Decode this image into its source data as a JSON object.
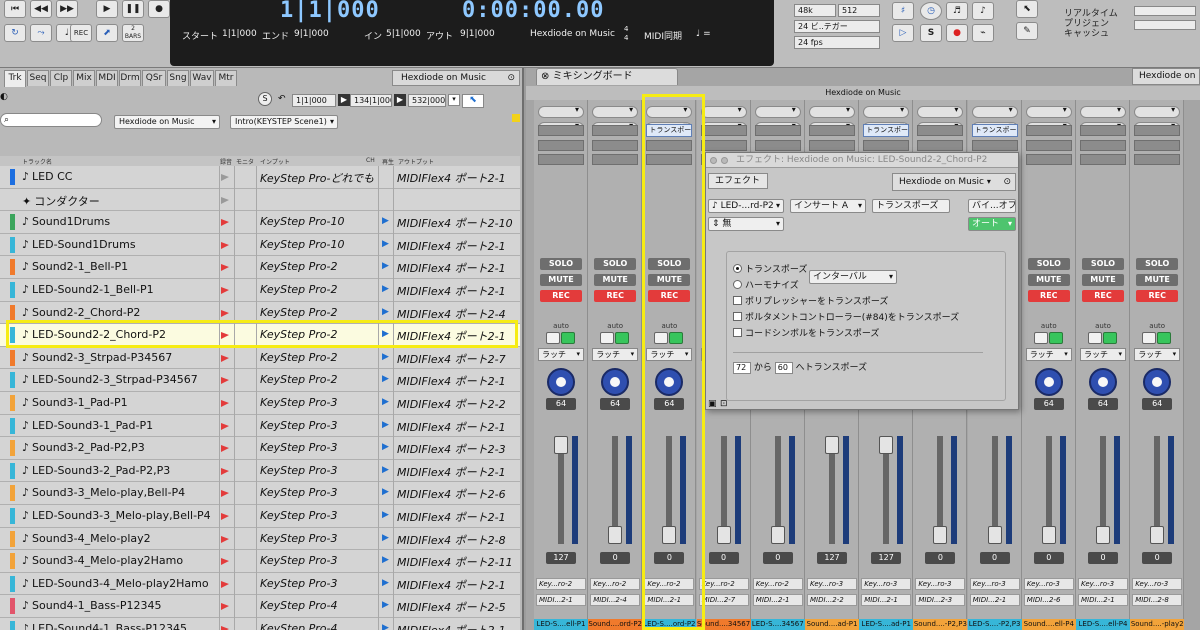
{
  "transport": {
    "measure": "1|1|000",
    "time": "0:00:00.00",
    "start_label": "スタート",
    "start_value": "1|1|000",
    "end_label": "エンド",
    "end_value": "9|1|000",
    "in_label": "イン",
    "in_value": "5|1|000",
    "out_label": "アウト",
    "out_value": "9|1|000",
    "project": "Hexdiode on Music",
    "time_sig_top": "4",
    "time_sig_bottom": "4",
    "midi_sync": "MIDI同期",
    "tempo_note": "♩ =",
    "rec_label": "REC",
    "bars_label": "2\nBARS",
    "sample_rate": "48k",
    "buffer": "512",
    "bit_depth": "24 ビ..テガー",
    "fps": "24 fps",
    "right_text": [
      "リアルタイム",
      "プリジェン",
      "キャッシュ"
    ]
  },
  "tracks_panel": {
    "tabs": [
      "Trk",
      "Seq",
      "Clp",
      "Mix",
      "MDI",
      "Drm",
      "QSr",
      "Sng",
      "Wav",
      "Mtr"
    ],
    "active_tab": "Trk",
    "title": "Hexdiode on Music",
    "project_select": "Hexdiode on Music",
    "scene_select": "Intro(KEYSTEP Scene1)",
    "counter_1": "1|1|000",
    "counter_2": "134|1|000",
    "counter_3": "532|000",
    "s_btn": "S",
    "col_track": "トラック名",
    "col_rec": "録音",
    "col_mon": "モニタ",
    "col_input": "インプット",
    "col_ch": "CH",
    "col_play": "再生",
    "col_output": "アウトプット",
    "rows": [
      {
        "name": "LED CC",
        "input": "KeyStep Pro-どれでも",
        "output": "MIDIFlex4 ポート2-1",
        "color": "#1c6ee0",
        "rec": false,
        "ch": false,
        "icon": "♪"
      },
      {
        "name": "コンダクター",
        "input": "",
        "output": "",
        "color": "#d4d4d4",
        "rec": false,
        "ch": false,
        "icon": "✦"
      },
      {
        "name": "Sound1Drums",
        "input": "KeyStep Pro-10",
        "output": "MIDIFlex4 ポート2-10",
        "color": "#3ba55c",
        "rec": true,
        "ch": true,
        "icon": "♪"
      },
      {
        "name": "LED-Sound1Drums",
        "input": "KeyStep Pro-10",
        "output": "MIDIFlex4 ポート2-1",
        "color": "#37b6d8",
        "rec": true,
        "ch": true,
        "icon": "♪"
      },
      {
        "name": "Sound2-1_Bell-P1",
        "input": "KeyStep Pro-2",
        "output": "MIDIFlex4 ポート2-1",
        "color": "#f07a2c",
        "rec": true,
        "ch": true,
        "icon": "♪"
      },
      {
        "name": "LED-Sound2-1_Bell-P1",
        "input": "KeyStep Pro-2",
        "output": "MIDIFlex4 ポート2-1",
        "color": "#37b6d8",
        "rec": true,
        "ch": true,
        "icon": "♪"
      },
      {
        "name": "Sound2-2_Chord-P2",
        "input": "KeyStep Pro-2",
        "output": "MIDIFlex4 ポート2-4",
        "color": "#f07a2c",
        "rec": true,
        "ch": true,
        "icon": "♪"
      },
      {
        "name": "LED-Sound2-2_Chord-P2",
        "input": "KeyStep Pro-2",
        "output": "MIDIFlex4 ポート2-1",
        "color": "#37b6d8",
        "rec": true,
        "ch": true,
        "icon": "♪"
      },
      {
        "name": "Sound2-3_Strpad-P34567",
        "input": "KeyStep Pro-2",
        "output": "MIDIFlex4 ポート2-7",
        "color": "#f07a2c",
        "rec": true,
        "ch": true,
        "icon": "♪"
      },
      {
        "name": "LED-Sound2-3_Strpad-P34567",
        "input": "KeyStep Pro-2",
        "output": "MIDIFlex4 ポート2-1",
        "color": "#37b6d8",
        "rec": true,
        "ch": true,
        "icon": "♪"
      },
      {
        "name": "Sound3-1_Pad-P1",
        "input": "KeyStep Pro-3",
        "output": "MIDIFlex4 ポート2-2",
        "color": "#f2a33a",
        "rec": true,
        "ch": true,
        "icon": "♪"
      },
      {
        "name": "LED-Sound3-1_Pad-P1",
        "input": "KeyStep Pro-3",
        "output": "MIDIFlex4 ポート2-1",
        "color": "#37b6d8",
        "rec": true,
        "ch": true,
        "icon": "♪"
      },
      {
        "name": "Sound3-2_Pad-P2,P3",
        "input": "KeyStep Pro-3",
        "output": "MIDIFlex4 ポート2-3",
        "color": "#f2a33a",
        "rec": true,
        "ch": true,
        "icon": "♪"
      },
      {
        "name": "LED-Sound3-2_Pad-P2,P3",
        "input": "KeyStep Pro-3",
        "output": "MIDIFlex4 ポート2-1",
        "color": "#37b6d8",
        "rec": true,
        "ch": true,
        "icon": "♪"
      },
      {
        "name": "Sound3-3_Melo-play,Bell-P4",
        "input": "KeyStep Pro-3",
        "output": "MIDIFlex4 ポート2-6",
        "color": "#f2a33a",
        "rec": true,
        "ch": true,
        "icon": "♪"
      },
      {
        "name": "LED-Sound3-3_Melo-play,Bell-P4",
        "input": "KeyStep Pro-3",
        "output": "MIDIFlex4 ポート2-1",
        "color": "#37b6d8",
        "rec": true,
        "ch": true,
        "icon": "♪"
      },
      {
        "name": "Sound3-4_Melo-play2",
        "input": "KeyStep Pro-3",
        "output": "MIDIFlex4 ポート2-8",
        "color": "#f2a33a",
        "rec": true,
        "ch": true,
        "icon": "♪"
      },
      {
        "name": "Sound3-4_Melo-play2Hamo",
        "input": "KeyStep Pro-3",
        "output": "MIDIFlex4 ポート2-11",
        "color": "#f2a33a",
        "rec": true,
        "ch": true,
        "icon": "♪"
      },
      {
        "name": "LED-Sound3-4_Melo-play2Hamo",
        "input": "KeyStep Pro-3",
        "output": "MIDIFlex4 ポート2-1",
        "color": "#37b6d8",
        "rec": true,
        "ch": true,
        "icon": "♪"
      },
      {
        "name": "Sound4-1_Bass-P12345",
        "input": "KeyStep Pro-4",
        "output": "MIDIFlex4 ポート2-5",
        "color": "#e2556b",
        "rec": true,
        "ch": true,
        "icon": "♪"
      },
      {
        "name": "LED-Sound4-1_Bass-P12345",
        "input": "KeyStep Pro-4",
        "output": "MIDIFlex4 ポート2-1",
        "color": "#37b6d8",
        "rec": true,
        "ch": true,
        "icon": "♪"
      }
    ]
  },
  "mixer": {
    "tab_label": "ミキシングボード",
    "right_tab": "Hexdiode on Music",
    "header": "Hexdiode on Music",
    "solo": "SOLO",
    "mute": "MUTE",
    "rec": "REC",
    "auto": "auto",
    "latch": "ラッチ",
    "insert_label": "トランスポー",
    "strips": [
      {
        "name": "LED-S....ell-P1",
        "in": "Key...ro-2",
        "out": "MIDI...2-1",
        "pan": "64",
        "vol": "127",
        "fader": 1.0,
        "color": "#37b6d8",
        "insert": false
      },
      {
        "name": "Sound....ord-P2",
        "in": "Key...ro-2",
        "out": "MIDI...2-4",
        "pan": "64",
        "vol": "0",
        "fader": 0.0,
        "color": "#f07a2c",
        "insert": false
      },
      {
        "name": "LED-S....ord-P2",
        "in": "Key...ro-2",
        "out": "MIDI...2-1",
        "pan": "64",
        "vol": "0",
        "fader": 0.0,
        "color": "#37b6d8",
        "insert": true
      },
      {
        "name": "Sound....34567",
        "in": "Key...ro-2",
        "out": "MIDI...2-7",
        "pan": "64",
        "vol": "0",
        "fader": 0.0,
        "color": "#f07a2c",
        "insert": false
      },
      {
        "name": "LED-S....34567",
        "in": "Key...ro-2",
        "out": "MIDI...2-1",
        "pan": "64",
        "vol": "0",
        "fader": 0.0,
        "color": "#37b6d8",
        "insert": false
      },
      {
        "name": "Sound....ad-P1",
        "in": "Key...ro-3",
        "out": "MIDI...2-2",
        "pan": "64",
        "vol": "127",
        "fader": 1.0,
        "color": "#f2a33a",
        "insert": false
      },
      {
        "name": "LED-S....ad-P1",
        "in": "Key...ro-3",
        "out": "MIDI...2-1",
        "pan": "64",
        "vol": "127",
        "fader": 1.0,
        "color": "#37b6d8",
        "insert": true
      },
      {
        "name": "Sound....-P2,P3",
        "in": "Key...ro-3",
        "out": "MIDI...2-3",
        "pan": "64",
        "vol": "0",
        "fader": 0.0,
        "color": "#f2a33a",
        "insert": false
      },
      {
        "name": "LED-S....-P2,P3",
        "in": "Key...ro-3",
        "out": "MIDI...2-1",
        "pan": "64",
        "vol": "0",
        "fader": 0.0,
        "color": "#37b6d8",
        "insert": true
      },
      {
        "name": "Sound....ell-P4",
        "in": "Key...ro-3",
        "out": "MIDI...2-6",
        "pan": "64",
        "vol": "0",
        "fader": 0.0,
        "color": "#f2a33a",
        "insert": false
      },
      {
        "name": "LED-S....ell-P4",
        "in": "Key...ro-3",
        "out": "MIDI...2-1",
        "pan": "64",
        "vol": "0",
        "fader": 0.0,
        "color": "#37b6d8",
        "insert": false
      },
      {
        "name": "Sound....-play2",
        "in": "Key...ro-3",
        "out": "MIDI...2-8",
        "pan": "64",
        "vol": "0",
        "fader": 0.0,
        "color": "#f2a33a",
        "insert": false
      }
    ]
  },
  "effect": {
    "title": "エフェクト: Hexdiode on Music: LED-Sound2-2_Chord-P2",
    "tab": "エフェクト",
    "panel_title": "Hexdiode on Music",
    "track_select": "LED-...rd-P2",
    "insert_select": "インサート A",
    "effect_name": "トランスポーズ",
    "bypass": "バイ...オフ",
    "preset": "無",
    "auto": "オート",
    "opt_transpose": "トランスポーズ",
    "opt_harmonize": "ハーモナイズ",
    "interval_select": "インターバル",
    "opt_polyphonic": "ポリプレッシャーをトランスポーズ",
    "opt_portamento": "ポルタメントコントローラー(#84)をトランスポーズ",
    "opt_chord": "コードシンボルをトランスポーズ",
    "from_value": "72",
    "from_label": "から",
    "to_value": "60",
    "to_label": "へトランスポーズ"
  }
}
